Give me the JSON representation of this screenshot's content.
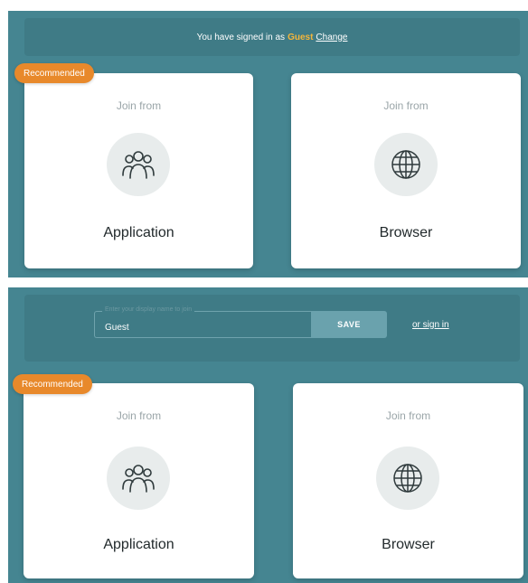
{
  "top_section": {
    "banner": {
      "prefix": "You have signed in as",
      "user": "Guest",
      "change_link": "Change"
    },
    "badge": "Recommended",
    "cards": [
      {
        "caption": "Join from",
        "title": "Application",
        "icon": "people-group-icon"
      },
      {
        "caption": "Join from",
        "title": "Browser",
        "icon": "globe-icon"
      }
    ]
  },
  "bottom_section": {
    "name_field": {
      "label": "Enter your display name to join",
      "value": "Guest"
    },
    "save_label": "SAVE",
    "signin_link": "or sign in",
    "badge": "Recommended",
    "cards": [
      {
        "caption": "Join from",
        "title": "Application",
        "icon": "people-group-icon"
      },
      {
        "caption": "Join from",
        "title": "Browser",
        "icon": "globe-icon"
      }
    ]
  },
  "colors": {
    "panel": "#458591",
    "accent_badge": "#e8892b",
    "guest_highlight": "#f4b63b",
    "save_button": "#6aa2ad"
  }
}
